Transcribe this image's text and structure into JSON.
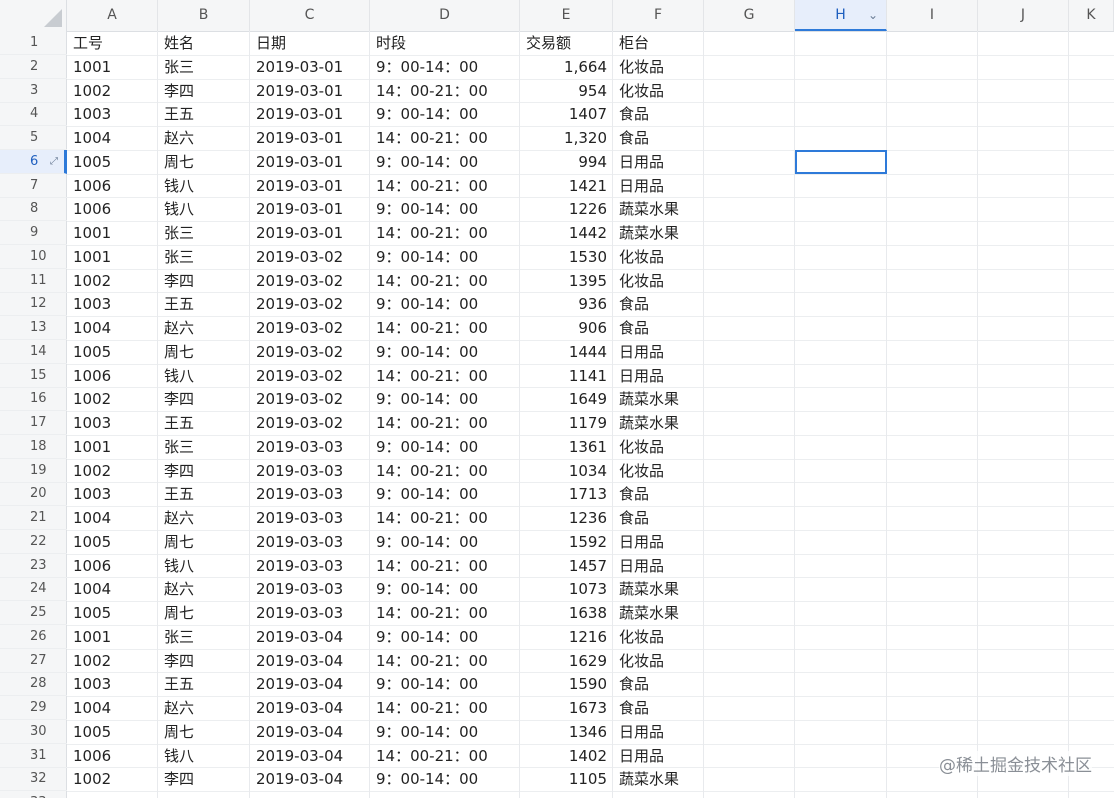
{
  "columns": [
    "A",
    "B",
    "C",
    "D",
    "E",
    "F",
    "G",
    "H",
    "I",
    "J",
    "K"
  ],
  "active_column": "H",
  "active_row": 6,
  "header_row": [
    "工号",
    "姓名",
    "日期",
    "时段",
    "交易额",
    "柜台"
  ],
  "rows": [
    [
      "1001",
      "张三",
      "2019-03-01",
      "9：00-14：00",
      "1,664",
      "化妆品"
    ],
    [
      "1002",
      "李四",
      "2019-03-01",
      "14：00-21：00",
      "954",
      "化妆品"
    ],
    [
      "1003",
      "王五",
      "2019-03-01",
      "9：00-14：00",
      "1407",
      "食品"
    ],
    [
      "1004",
      "赵六",
      "2019-03-01",
      "14：00-21：00",
      "1,320",
      "食品"
    ],
    [
      "1005",
      "周七",
      "2019-03-01",
      "9：00-14：00",
      "994",
      "日用品"
    ],
    [
      "1006",
      "钱八",
      "2019-03-01",
      "14：00-21：00",
      "1421",
      "日用品"
    ],
    [
      "1006",
      "钱八",
      "2019-03-01",
      "9：00-14：00",
      "1226",
      "蔬菜水果"
    ],
    [
      "1001",
      "张三",
      "2019-03-01",
      "14：00-21：00",
      "1442",
      "蔬菜水果"
    ],
    [
      "1001",
      "张三",
      "2019-03-02",
      "9：00-14：00",
      "1530",
      "化妆品"
    ],
    [
      "1002",
      "李四",
      "2019-03-02",
      "14：00-21：00",
      "1395",
      "化妆品"
    ],
    [
      "1003",
      "王五",
      "2019-03-02",
      "9：00-14：00",
      "936",
      "食品"
    ],
    [
      "1004",
      "赵六",
      "2019-03-02",
      "14：00-21：00",
      "906",
      "食品"
    ],
    [
      "1005",
      "周七",
      "2019-03-02",
      "9：00-14：00",
      "1444",
      "日用品"
    ],
    [
      "1006",
      "钱八",
      "2019-03-02",
      "14：00-21：00",
      "1141",
      "日用品"
    ],
    [
      "1002",
      "李四",
      "2019-03-02",
      "9：00-14：00",
      "1649",
      "蔬菜水果"
    ],
    [
      "1003",
      "王五",
      "2019-03-02",
      "14：00-21：00",
      "1179",
      "蔬菜水果"
    ],
    [
      "1001",
      "张三",
      "2019-03-03",
      "9：00-14：00",
      "1361",
      "化妆品"
    ],
    [
      "1002",
      "李四",
      "2019-03-03",
      "14：00-21：00",
      "1034",
      "化妆品"
    ],
    [
      "1003",
      "王五",
      "2019-03-03",
      "9：00-14：00",
      "1713",
      "食品"
    ],
    [
      "1004",
      "赵六",
      "2019-03-03",
      "14：00-21：00",
      "1236",
      "食品"
    ],
    [
      "1005",
      "周七",
      "2019-03-03",
      "9：00-14：00",
      "1592",
      "日用品"
    ],
    [
      "1006",
      "钱八",
      "2019-03-03",
      "14：00-21：00",
      "1457",
      "日用品"
    ],
    [
      "1004",
      "赵六",
      "2019-03-03",
      "9：00-14：00",
      "1073",
      "蔬菜水果"
    ],
    [
      "1005",
      "周七",
      "2019-03-03",
      "14：00-21：00",
      "1638",
      "蔬菜水果"
    ],
    [
      "1001",
      "张三",
      "2019-03-04",
      "9：00-14：00",
      "1216",
      "化妆品"
    ],
    [
      "1002",
      "李四",
      "2019-03-04",
      "14：00-21：00",
      "1629",
      "化妆品"
    ],
    [
      "1003",
      "王五",
      "2019-03-04",
      "9：00-14：00",
      "1590",
      "食品"
    ],
    [
      "1004",
      "赵六",
      "2019-03-04",
      "14：00-21：00",
      "1673",
      "食品"
    ],
    [
      "1005",
      "周七",
      "2019-03-04",
      "9：00-14：00",
      "1346",
      "日用品"
    ],
    [
      "1006",
      "钱八",
      "2019-03-04",
      "14：00-21：00",
      "1402",
      "日用品"
    ],
    [
      "1002",
      "李四",
      "2019-03-04",
      "9：00-14：00",
      "1105",
      "蔬菜水果"
    ]
  ],
  "icons": {
    "corner": "select-all-triangle-icon",
    "column_menu": "chevron-down-icon",
    "row_expand": "expand-arrows-icon"
  },
  "watermark": "@稀土掘金技术社区",
  "colors": {
    "accent": "#2e7ad9",
    "header_bg": "#f5f6f7",
    "active_header_bg": "#e7eefb"
  }
}
